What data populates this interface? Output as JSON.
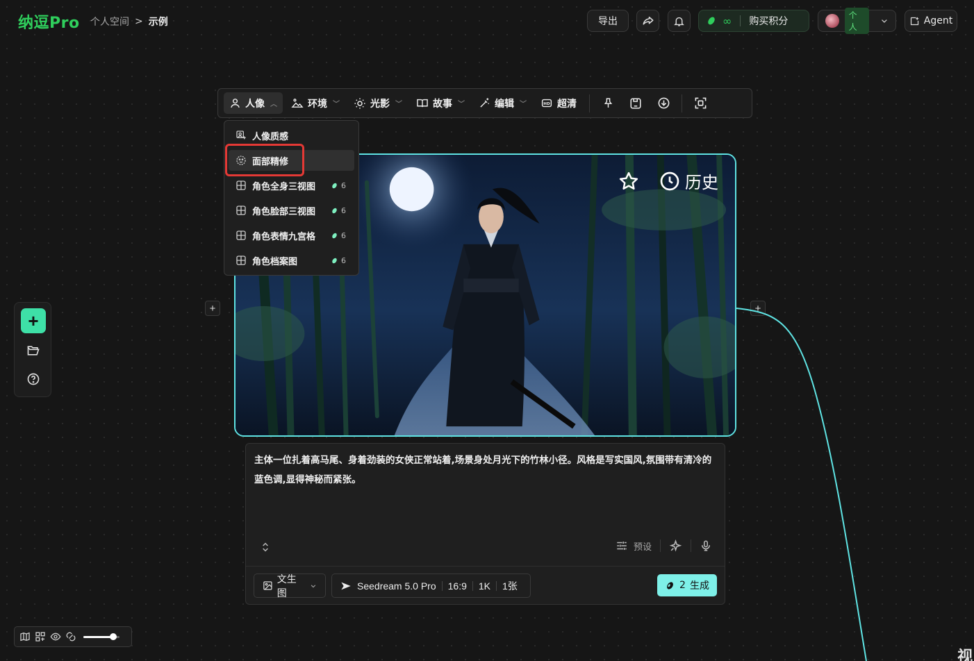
{
  "header": {
    "logo": "纳逗Pro",
    "breadcrumb": {
      "parent": "个人空间",
      "separator": ">",
      "current": "示例"
    },
    "export_label": "导出",
    "points_value": "∞",
    "buy_points_label": "购买积分",
    "user_tag": "个人",
    "agent_label": "Agent"
  },
  "toolbar": {
    "items": [
      {
        "label": "人像",
        "icon": "person-icon",
        "active": true
      },
      {
        "label": "环境",
        "icon": "landscape-icon"
      },
      {
        "label": "光影",
        "icon": "sun-icon"
      },
      {
        "label": "故事",
        "icon": "book-icon"
      },
      {
        "label": "编辑",
        "icon": "magic-wand-icon"
      },
      {
        "label": "超清",
        "icon": "hd-icon"
      }
    ],
    "action_icons": [
      "pin-icon",
      "save-icon",
      "download-icon",
      "focus-icon"
    ]
  },
  "dropdown": {
    "items": [
      {
        "label": "人像质感"
      },
      {
        "label": "面部精修",
        "highlighted": true
      },
      {
        "label": "角色全身三视图",
        "cost": "6"
      },
      {
        "label": "角色脸部三视图",
        "cost": "6"
      },
      {
        "label": "角色表情九宫格",
        "cost": "6"
      },
      {
        "label": "角色档案图",
        "cost": "6"
      }
    ]
  },
  "image_card": {
    "history_label": "历史"
  },
  "prompt": {
    "text": "主体一位扎着高马尾、身着劲装的女侠正常站着,场景身处月光下的竹林小径。风格是写实国风,氛围带有清冷的蓝色调,显得神秘而紧张。",
    "preset_label": "预设",
    "mode_label": "文生图",
    "model_label": "Seedream 5.0 Pro",
    "ratio": "16:9",
    "resolution": "1K",
    "count": "1张",
    "generate_cost": "2",
    "generate_label": "生成"
  },
  "view": {
    "zoom_fraction": 0.82
  },
  "corner_text": "视",
  "colors": {
    "brand_green": "#2fce5c",
    "accent_cyan": "#5fe4e4",
    "generate_bg": "#7ef0e8",
    "highlight_red": "#e53935"
  }
}
